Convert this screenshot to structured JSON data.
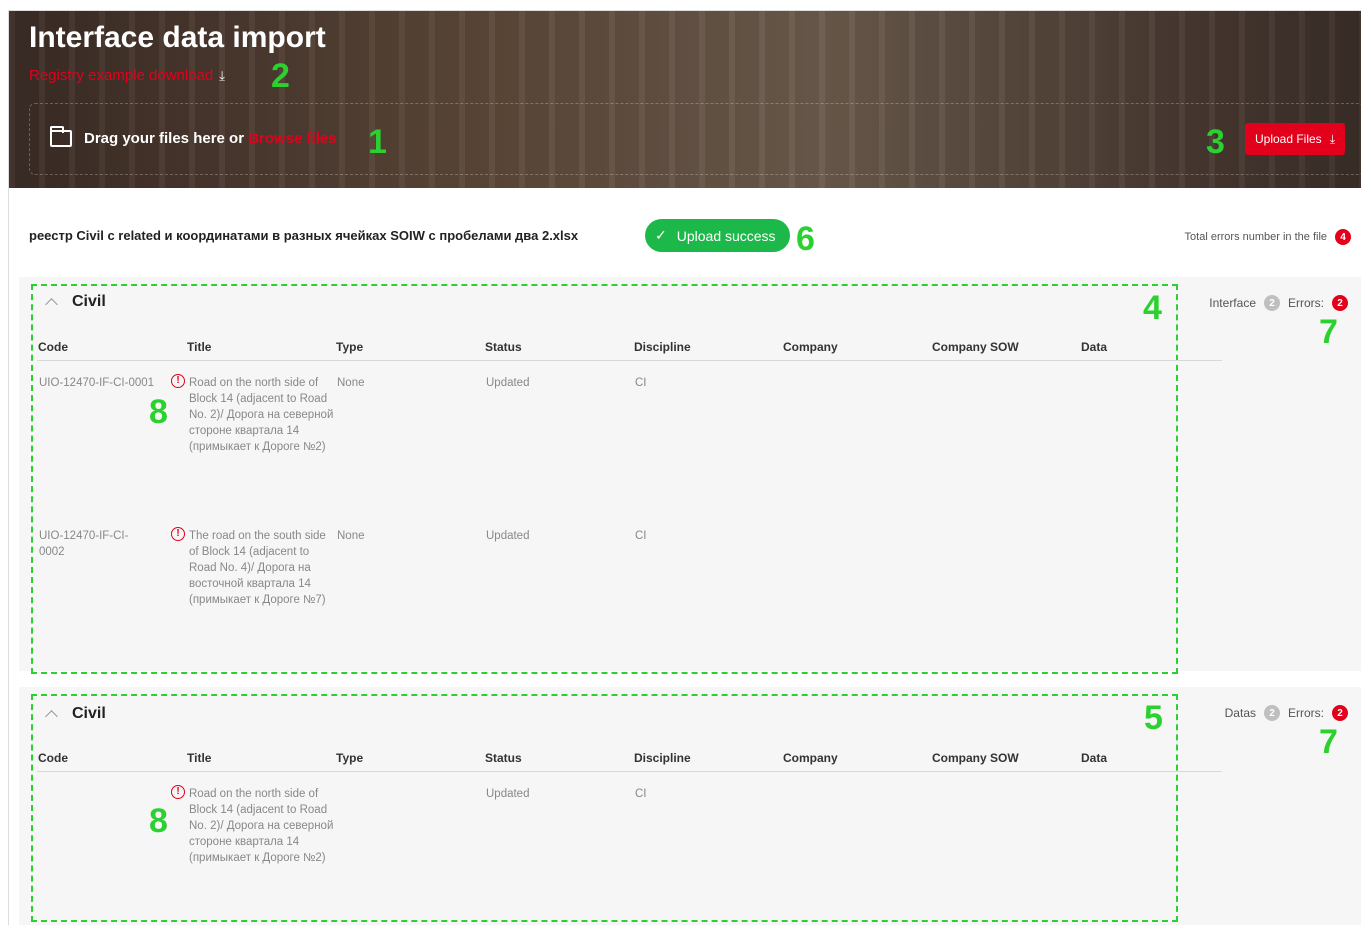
{
  "header": {
    "title": "Interface data import",
    "registry_link": "Registry example download",
    "drag_text": "Drag your files here or ",
    "browse_text": "Browse files",
    "upload_button": "Upload Files"
  },
  "file": {
    "name": "реестр Civil c related и координатами в разных ячейках SOIW с пробелами два 2.xlsx",
    "status": "Upload success",
    "total_errors_label": "Total errors number in the file",
    "total_errors_count": "4"
  },
  "markers": {
    "m1": "1",
    "m2": "2",
    "m3": "3",
    "m4": "4",
    "m5": "5",
    "m6": "6",
    "m7": "7",
    "m8": "8"
  },
  "columns": [
    "Code",
    "Title",
    "Type",
    "Status",
    "Discipline",
    "Company",
    "Company SOW",
    "Data"
  ],
  "interface_section": {
    "title": "Civil",
    "count_label": "Interface",
    "count": "2",
    "errors_label": "Errors:",
    "errors": "2",
    "rows": [
      {
        "code": "UIO-12470-IF-CI-0001",
        "title": "Road on the north side of Block 14 (adjacent to Road No. 2)/ Дорога на северной стороне квартала 14 (примыкает к Дороге №2)",
        "type": "None",
        "status": "Updated",
        "discipline": "CI"
      },
      {
        "code": "UIO-12470-IF-CI-0002",
        "title": "The road on the south side of Block 14 (adjacent to Road No. 4)/ Дорога на восточной квартала 14 (примыкает к Дороге №7)",
        "type": "None",
        "status": "Updated",
        "discipline": "CI"
      }
    ]
  },
  "data_section": {
    "title": "Civil",
    "count_label": "Datas",
    "count": "2",
    "errors_label": "Errors:",
    "errors": "2",
    "rows": [
      {
        "code": "",
        "title": "Road on the north side of Block 14 (adjacent to Road No. 2)/ Дорога на северной стороне квартала 14 (примыкает к Дороге №2)",
        "type": "",
        "status": "Updated",
        "discipline": "CI"
      }
    ]
  },
  "colors": {
    "accent": "#e3001b",
    "success": "#1db84a",
    "annotation": "#2bd12f"
  },
  "icons": [
    "download-icon",
    "folder-icon",
    "check-icon",
    "error-icon",
    "chevron-up-icon"
  ]
}
